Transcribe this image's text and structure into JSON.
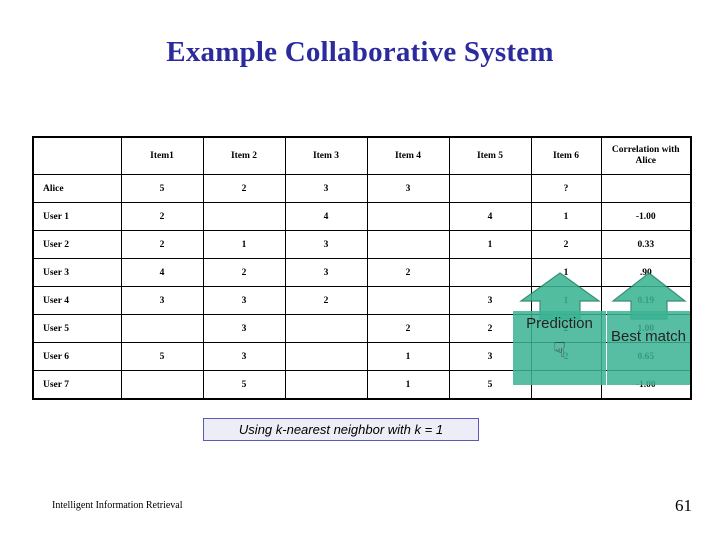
{
  "slide": {
    "title": "Example Collaborative System",
    "page_number": "61",
    "footer": "Intelligent Information Retrieval",
    "caption": "Using k-nearest neighbor with k = 1"
  },
  "colors": {
    "title": "#2B2B9E",
    "accent_green": "#3CB494",
    "dim_text": "#BFC6E0",
    "caption_bg": "#EDEDF7",
    "caption_border": "#5A5AB4"
  },
  "table": {
    "corner": "",
    "headers": [
      "Item1",
      "Item 2",
      "Item 3",
      "Item 4",
      "Item 5",
      "Item 6",
      "Correlation with Alice"
    ],
    "rows": [
      {
        "label": "Alice",
        "cells": [
          "5",
          "2",
          "3",
          "3",
          "",
          "?",
          ""
        ]
      },
      {
        "label": "User 1",
        "cells": [
          "2",
          "",
          "4",
          "",
          "4",
          "1",
          "-1.00"
        ]
      },
      {
        "label": "User 2",
        "cells": [
          "2",
          "1",
          "3",
          "",
          "1",
          "2",
          "0.33"
        ]
      },
      {
        "label": "User 3",
        "cells": [
          "4",
          "2",
          "3",
          "2",
          "",
          "1",
          ".90"
        ]
      },
      {
        "label": "User 4",
        "cells": [
          "3",
          "3",
          "2",
          "",
          "3",
          "1",
          "0.19"
        ]
      },
      {
        "label": "User 5",
        "cells": [
          "",
          "3",
          "",
          "2",
          "2",
          "2",
          "1.00"
        ]
      },
      {
        "label": "User 6",
        "cells": [
          "5",
          "3",
          "",
          "1",
          "3",
          "2",
          "0.65"
        ]
      },
      {
        "label": "User 7",
        "cells": [
          "",
          "5",
          "",
          "1",
          "5",
          "",
          "-1.00"
        ]
      }
    ]
  },
  "annotations": {
    "prediction_label": "Prediction",
    "best_match_label": "Best match",
    "hand_icon": "hand-pointing-icon",
    "hand_glyph": "☟"
  }
}
